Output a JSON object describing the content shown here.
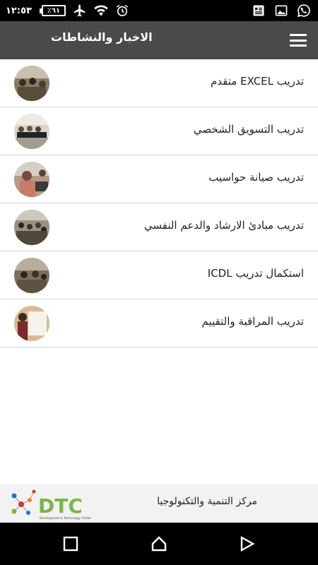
{
  "status_bar": {
    "time": "١٢:٥٣",
    "battery_level": "٪٦١",
    "icons": [
      "whatsapp-icon",
      "image-icon",
      "news-icon",
      "alarm-icon",
      "wifi-icon",
      "airplane-icon"
    ]
  },
  "app_bar": {
    "title": "الاخبار والنشاطات",
    "menu_icon": "hamburger-menu-icon"
  },
  "news_items": [
    {
      "label": "تدريب EXCEL متقدم"
    },
    {
      "label": "تدريب التسويق الشخصي"
    },
    {
      "label": "تدريب صيانة حواسيب"
    },
    {
      "label": "تدريب مبادئ الارشاد والدعم النفسي"
    },
    {
      "label": "استكمال تدريب ICDL"
    },
    {
      "label": "تدريب المراقبة والتقييم"
    }
  ],
  "footer": {
    "org_name": "مركز التنمية والتكنولوجيا",
    "logo_text": "DTC",
    "logo_subtext": "Development & Technology Center",
    "colors": {
      "green": "#7ab648",
      "red": "#d9352a",
      "blue": "#2a6fb5",
      "orange": "#f08a1c"
    }
  },
  "nav_bar": {
    "icons": [
      "recent-apps-icon",
      "home-icon",
      "back-icon"
    ]
  }
}
